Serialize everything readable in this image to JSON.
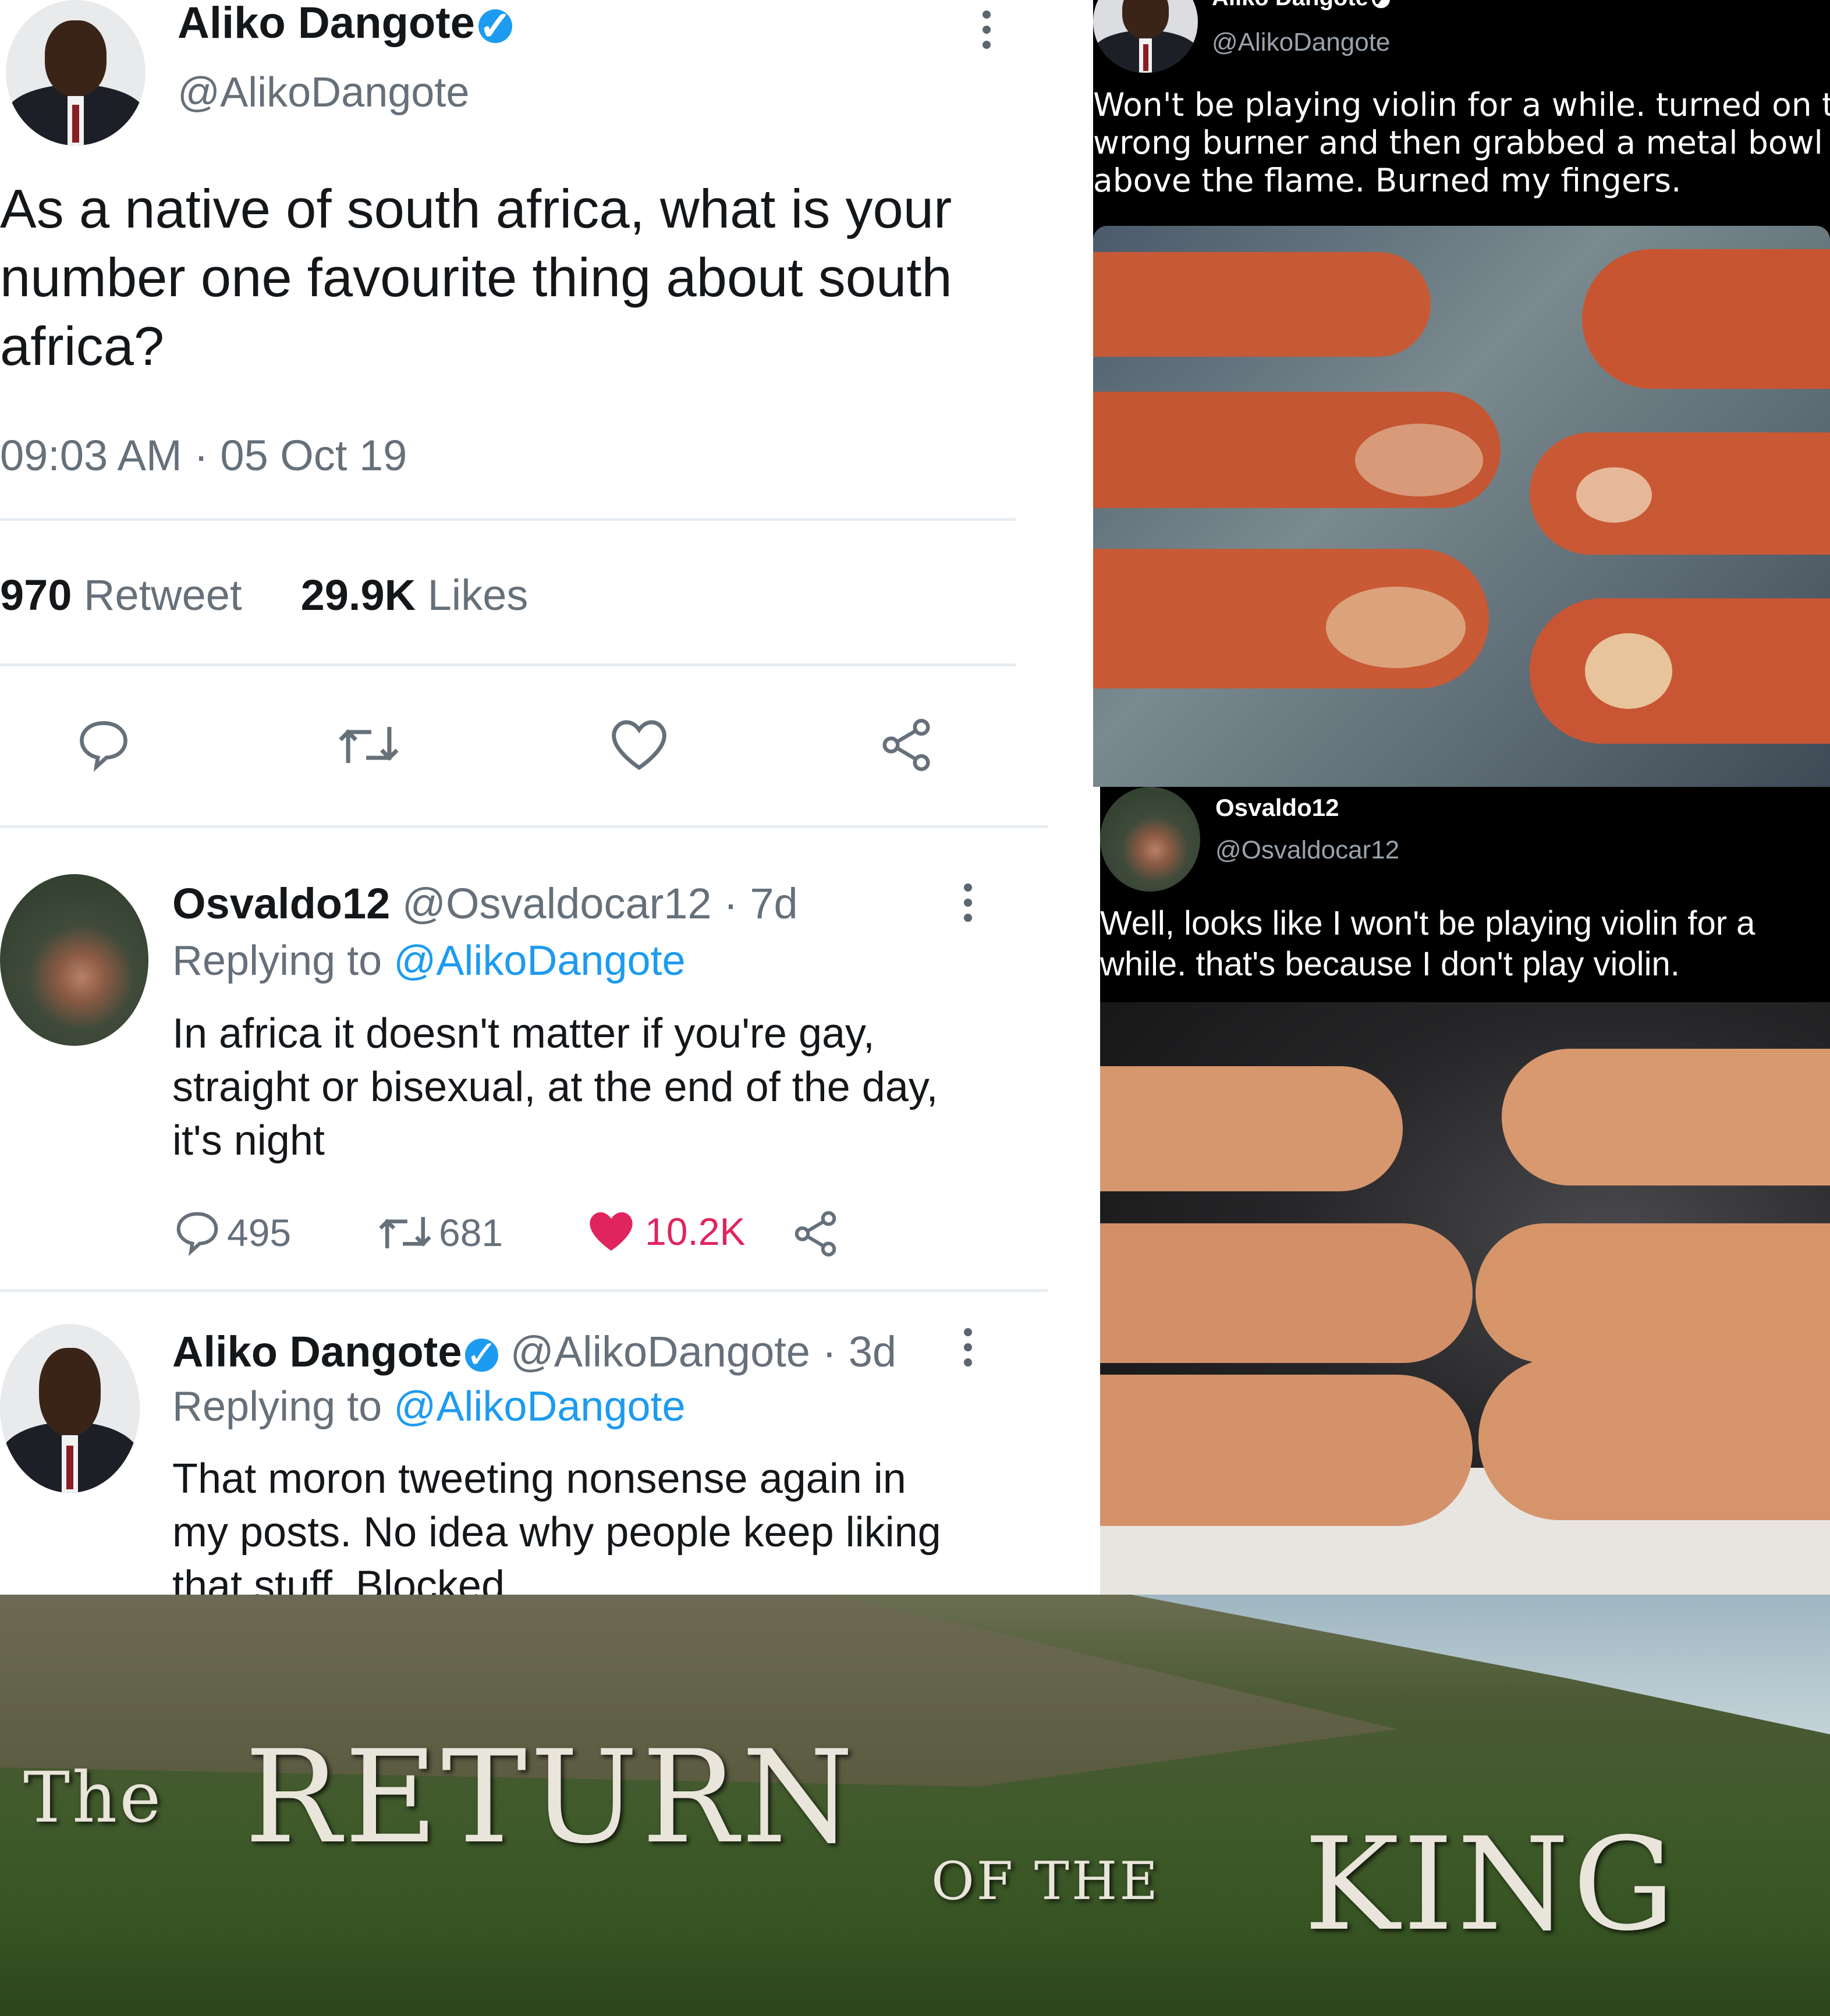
{
  "main_tweet": {
    "author_name": "Aliko Dangote",
    "author_handle": "@AlikoDangote",
    "text_lines": [
      "As a native of south africa, what is your",
      "number one favourite thing about south",
      "africa?"
    ],
    "timestamp": "09:03 AM · 05 Oct 19",
    "retweet_count": "970",
    "retweet_label": "Retweet",
    "likes_count": "29.9K",
    "likes_label": "Likes"
  },
  "reply1": {
    "author_name": "Osvaldo12",
    "handle_time": "@Osvaldocar12 · 7d",
    "replying_prefix": "Replying to",
    "replying_to": "@AlikoDangote",
    "text_lines": [
      "In africa it doesn't matter if you're gay,",
      "straight or bisexual, at the end of the day,",
      "it's night"
    ],
    "reply_count": "495",
    "retweet_count": "681",
    "like_count": "10.2K"
  },
  "reply2": {
    "author_name": "Aliko Dangote",
    "handle_time": "@AlikoDangote · 3d",
    "replying_prefix": "Replying to",
    "replying_to": "@AlikoDangote",
    "text_lines": [
      "That moron tweeting nonsense again in",
      "my posts. No idea why people keep liking",
      "that stuff. Blocked"
    ]
  },
  "dark_tweet1": {
    "author_name": "Aliko Dangote",
    "author_handle": "@AlikoDangote",
    "text_lines": [
      "Won't be playing violin for a while. turned on the",
      "wrong burner and then grabbed a metal bowl",
      "above the flame. Burned my fingers."
    ]
  },
  "dark_tweet2": {
    "author_name": "Osvaldo12",
    "author_handle": "@Osvaldocar12",
    "text_lines": [
      "Well, looks like I won't be playing violin for a",
      "while. that's because I don't play violin."
    ]
  },
  "banner": {
    "line1_small": "The",
    "line1_big": "RETURN",
    "line2_small": "OF THE",
    "line2_big": "KING"
  },
  "colors": {
    "twitter_blue": "#1d9bf0",
    "like_red": "#e0245e",
    "text_dark": "#14171a",
    "text_muted": "#66707a"
  },
  "icons": [
    "verified-badge-icon",
    "kebab-menu-icon",
    "reply-icon",
    "retweet-icon",
    "heart-icon",
    "share-icon"
  ]
}
